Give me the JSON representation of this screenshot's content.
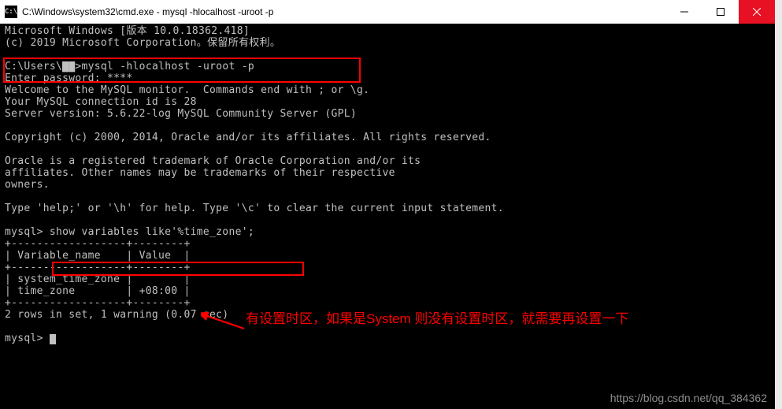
{
  "titlebar": {
    "icon_label": "C:\\",
    "title": "C:\\Windows\\system32\\cmd.exe - mysql   -hlocalhost -uroot -p",
    "minimize": "—",
    "maximize": "□",
    "close": "×"
  },
  "terminal": {
    "header": "Microsoft Windows [版本 10.0.18362.418]\n(c) 2019 Microsoft Corporation。保留所有权利。\n",
    "prompt_path": "C:\\Users\\",
    "prompt_redacted": "▇▇",
    "prompt_suffix": ">",
    "login_cmd": "mysql -hlocalhost -uroot -p",
    "enter_password": "Enter password: ****",
    "welcome": "Welcome to the MySQL monitor.  Commands end with ; or \\g.\nYour MySQL connection id is 28\nServer version: 5.6.22-log MySQL Community Server (GPL)\n\nCopyright (c) 2000, 2014, Oracle and/or its affiliates. All rights reserved.\n\nOracle is a registered trademark of Oracle Corporation and/or its\naffiliates. Other names may be trademarks of their respective\nowners.\n\nType 'help;' or '\\h' for help. Type '\\c' to clear the current input statement.\n",
    "mysql_prompt": "mysql>",
    "query": " show variables like'%time_zone';",
    "table_border": "+------------------+--------+",
    "table_header": "| Variable_name    | Value  |",
    "table_row1": "| system_time_zone |        |",
    "table_row2": "| time_zone        | +08:00 |",
    "result_footer": "2 rows in set, 1 warning (0.07 sec)\n"
  },
  "annotation": {
    "text": "有设置时区，如果是System 则没有设置时区，就需要再设置一下"
  },
  "watermark": {
    "text": "https://blog.csdn.net/qq_384362"
  },
  "chart_data": {
    "type": "table",
    "title": "show variables like '%time_zone';",
    "columns": [
      "Variable_name",
      "Value"
    ],
    "rows": [
      [
        "system_time_zone",
        ""
      ],
      [
        "time_zone",
        "+08:00"
      ]
    ],
    "footer": "2 rows in set, 1 warning (0.07 sec)"
  }
}
